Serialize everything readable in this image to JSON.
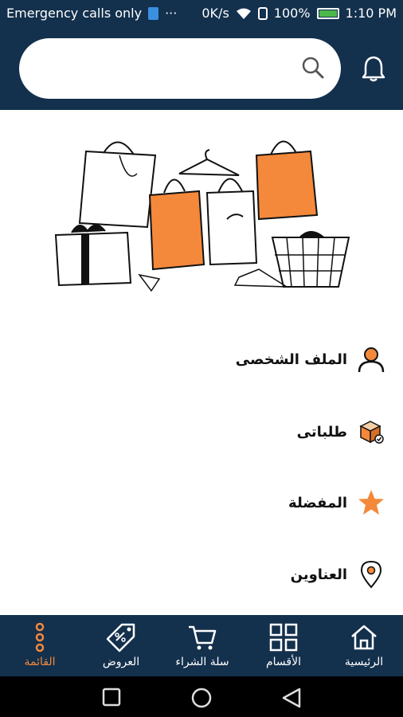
{
  "status": {
    "carrier": "Emergency calls only",
    "dots": "···",
    "speed": "0K/s",
    "battery": "100%",
    "time": "1:10 PM"
  },
  "search": {
    "placeholder": ""
  },
  "menu": [
    {
      "label": "الملف الشخصى",
      "icon": "person-icon"
    },
    {
      "label": "طلباتى",
      "icon": "package-icon"
    },
    {
      "label": "المفضلة",
      "icon": "star-icon"
    },
    {
      "label": "العناوين",
      "icon": "location-pin-icon"
    }
  ],
  "nav": {
    "home": "الرئيسية",
    "categories": "الأقسام",
    "cart": "سلة الشراء",
    "offers": "العروض",
    "menu": "القائمة"
  },
  "colors": {
    "header": "#13304d",
    "accent": "#f4893b",
    "text": "#111111"
  }
}
